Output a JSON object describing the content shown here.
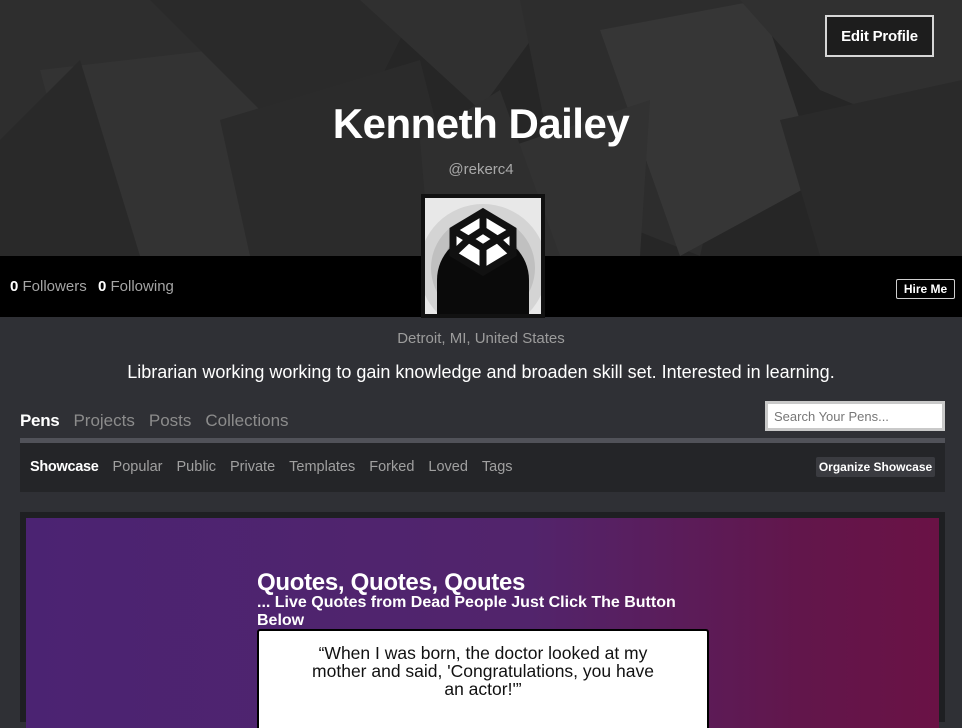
{
  "header": {
    "name": "Kenneth Dailey",
    "handle": "@rekerc4",
    "edit_label": "Edit Profile"
  },
  "stats": {
    "followers_count": "0",
    "followers_label": "Followers",
    "following_count": "0",
    "following_label": "Following",
    "hire_label": "Hire Me"
  },
  "profile": {
    "location": "Detroit, MI, United States",
    "bio": "Librarian working working to gain knowledge and broaden skill set. Interested in learning."
  },
  "tabs": [
    {
      "label": "Pens",
      "active": true
    },
    {
      "label": "Projects",
      "active": false
    },
    {
      "label": "Posts",
      "active": false
    },
    {
      "label": "Collections",
      "active": false
    }
  ],
  "search": {
    "placeholder": "Search Your Pens..."
  },
  "subtabs": [
    {
      "label": "Showcase",
      "active": true
    },
    {
      "label": "Popular",
      "active": false
    },
    {
      "label": "Public",
      "active": false
    },
    {
      "label": "Private",
      "active": false
    },
    {
      "label": "Templates",
      "active": false
    },
    {
      "label": "Forked",
      "active": false
    },
    {
      "label": "Loved",
      "active": false
    },
    {
      "label": "Tags",
      "active": false
    }
  ],
  "organize_label": "Organize Showcase",
  "showcase": {
    "title": "Quotes, Quotes, Qoutes",
    "subtitle": "... Live Quotes from Dead People Just Click The Button Below",
    "quote": "“When I was born, the doctor looked at my mother and said, 'Congratulations, you have an actor!'”"
  },
  "colors": {
    "page_bg": "#2f3035",
    "hero_bg": "#262626",
    "card_gradient_start": "#4b2372",
    "card_gradient_end": "#6a1245"
  },
  "icons": {
    "avatar": "codepen-cube-logo"
  }
}
